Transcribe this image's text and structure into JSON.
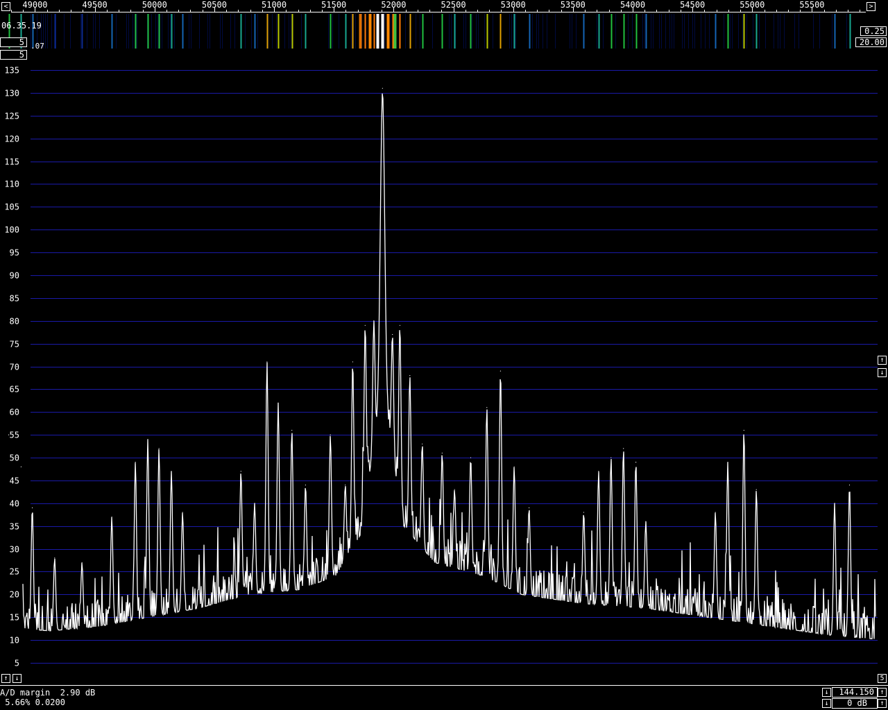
{
  "toolbar": {
    "scroll_left_glyph": "<",
    "scroll_right_glyph": ">",
    "time": "06.35.19",
    "avg_value": "5",
    "small_value": ".07",
    "gain_value": "0.25",
    "range_value": "20.00",
    "spectrum_avg_value": "5"
  },
  "side": {
    "up_glyph": "↑",
    "down_glyph": "↓",
    "bottom_right_value": "5"
  },
  "status": {
    "ad_margin": "A/D margin  2.90 dB",
    "line2": " 5.66% 0.0200",
    "freq": "144.150",
    "db": "0 dB"
  },
  "colors": {
    "grid": "#1a1aa8",
    "trace": "#ffffff",
    "waterfall_bg": "#00004a"
  },
  "freq_axis": {
    "min": 48800,
    "max": 55950,
    "ticks": [
      "49000",
      "49500",
      "50000",
      "50500",
      "51000",
      "51500",
      "52000",
      "52500",
      "53000",
      "53500",
      "54000",
      "54500",
      "55000",
      "55500"
    ]
  },
  "chart_data": {
    "type": "line",
    "title": "",
    "xlabel": "",
    "ylabel": "",
    "xlim": [
      48800,
      55950
    ],
    "ylim": [
      0,
      140
    ],
    "yticks": [
      "5",
      "10",
      "15",
      "20",
      "25",
      "30",
      "35",
      "40",
      "45",
      "50",
      "55",
      "60",
      "65",
      "70",
      "75",
      "80",
      "85",
      "90",
      "95",
      "100",
      "105",
      "110",
      "115",
      "120",
      "125",
      "130",
      "135"
    ],
    "grid": true,
    "peaks": [
      {
        "x": 48870,
        "y": 55
      },
      {
        "x": 48970,
        "y": 48
      },
      {
        "x": 49060,
        "y": 39
      },
      {
        "x": 49240,
        "y": 28
      },
      {
        "x": 49460,
        "y": 27
      },
      {
        "x": 49700,
        "y": 37
      },
      {
        "x": 49890,
        "y": 49
      },
      {
        "x": 49990,
        "y": 54
      },
      {
        "x": 50080,
        "y": 52
      },
      {
        "x": 50180,
        "y": 47
      },
      {
        "x": 50270,
        "y": 38
      },
      {
        "x": 50740,
        "y": 47
      },
      {
        "x": 50850,
        "y": 40
      },
      {
        "x": 50950,
        "y": 71
      },
      {
        "x": 51040,
        "y": 62
      },
      {
        "x": 51150,
        "y": 56
      },
      {
        "x": 51260,
        "y": 44
      },
      {
        "x": 51460,
        "y": 55
      },
      {
        "x": 51580,
        "y": 44
      },
      {
        "x": 51640,
        "y": 71
      },
      {
        "x": 51740,
        "y": 79
      },
      {
        "x": 51810,
        "y": 80
      },
      {
        "x": 51880,
        "y": 131
      },
      {
        "x": 51960,
        "y": 77
      },
      {
        "x": 52020,
        "y": 79
      },
      {
        "x": 52100,
        "y": 68
      },
      {
        "x": 52200,
        "y": 53
      },
      {
        "x": 52360,
        "y": 51
      },
      {
        "x": 52460,
        "y": 43
      },
      {
        "x": 52590,
        "y": 50
      },
      {
        "x": 52720,
        "y": 61
      },
      {
        "x": 52830,
        "y": 69
      },
      {
        "x": 52940,
        "y": 48
      },
      {
        "x": 53060,
        "y": 39
      },
      {
        "x": 53500,
        "y": 38
      },
      {
        "x": 53620,
        "y": 47
      },
      {
        "x": 53720,
        "y": 50
      },
      {
        "x": 53820,
        "y": 52
      },
      {
        "x": 53920,
        "y": 49
      },
      {
        "x": 54000,
        "y": 36
      },
      {
        "x": 54560,
        "y": 38
      },
      {
        "x": 54660,
        "y": 49
      },
      {
        "x": 54790,
        "y": 56
      },
      {
        "x": 54890,
        "y": 43
      },
      {
        "x": 55520,
        "y": 40
      },
      {
        "x": 55640,
        "y": 44
      }
    ],
    "noise_floor": [
      [
        48800,
        13
      ],
      [
        49200,
        12
      ],
      [
        49600,
        13
      ],
      [
        50000,
        15
      ],
      [
        50400,
        17
      ],
      [
        50800,
        20
      ],
      [
        51200,
        21
      ],
      [
        51500,
        24
      ],
      [
        51700,
        33
      ],
      [
        51850,
        60
      ],
      [
        51880,
        70
      ],
      [
        51910,
        60
      ],
      [
        52050,
        35
      ],
      [
        52300,
        27
      ],
      [
        52700,
        24
      ],
      [
        53000,
        20
      ],
      [
        53500,
        18
      ],
      [
        54000,
        17
      ],
      [
        54500,
        15
      ],
      [
        55000,
        13
      ],
      [
        55500,
        11
      ],
      [
        55950,
        10
      ]
    ]
  }
}
